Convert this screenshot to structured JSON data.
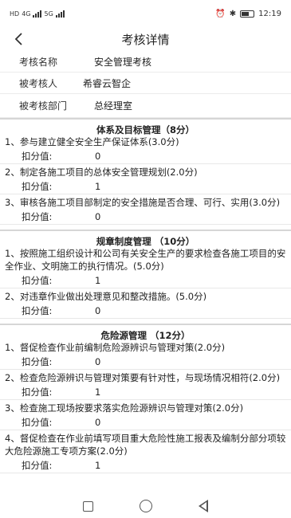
{
  "status_bar": {
    "left_text": "HD",
    "net1": "4G",
    "net2": "5G",
    "time": "12:19"
  },
  "header": {
    "back_icon": "chevron-left-icon",
    "title": "考核详情"
  },
  "info": [
    {
      "label": "考核名称",
      "value": "安全管理考核"
    },
    {
      "label": "被考核人",
      "value": "希睿云智企"
    },
    {
      "label": "被考核部门",
      "value": "总经理室"
    }
  ],
  "sections": [
    {
      "title": "体系及目标管理（8分）",
      "items": [
        {
          "text": "1、参与建立健全安全生产保证体系(3.0分)",
          "score_label": "扣分值:",
          "score": "0"
        },
        {
          "text": "2、制定各施工项目的总体安全管理规划(2.0分)",
          "score_label": "扣分值:",
          "score": "1"
        },
        {
          "text": "3、审核各施工项目部制定的安全措施是否合理、可行、实用(3.0分)",
          "score_label": "扣分值:",
          "score": "0"
        }
      ]
    },
    {
      "title": "规章制度管理 （10分）",
      "items": [
        {
          "text": "1、按照施工组织设计和公司有关安全生产的要求检查各施工项目的安全作业、文明施工的执行情况。(5.0分)",
          "score_label": "扣分值:",
          "score": "1"
        },
        {
          "text": "2、对违章作业做出处理意见和整改措施。(5.0分)",
          "score_label": "扣分值:",
          "score": "0"
        }
      ]
    },
    {
      "title": "危险源管理 （12分）",
      "items": [
        {
          "text": "1、督促检查作业前编制危险源辨识与管理对策(2.0分)",
          "score_label": "扣分值:",
          "score": "0"
        },
        {
          "text": "2、检查危险源辨识与管理对策要有针对性，与现场情况相符(2.0分)",
          "score_label": "扣分值:",
          "score": "1"
        },
        {
          "text": "3、检查施工现场按要求落实危险源辨识与管理对策(2.0分)",
          "score_label": "扣分值:",
          "score": "0"
        },
        {
          "text": "4、督促检查在作业前填写项目重大危险性施工报表及编制分部分项较大危险源施工专项方案(2.0分)",
          "score_label": "扣分值:",
          "score": "1"
        }
      ]
    }
  ],
  "nav": {
    "recent_icon": "square-icon",
    "home_icon": "circle-icon",
    "back_icon": "triangle-back-icon"
  }
}
